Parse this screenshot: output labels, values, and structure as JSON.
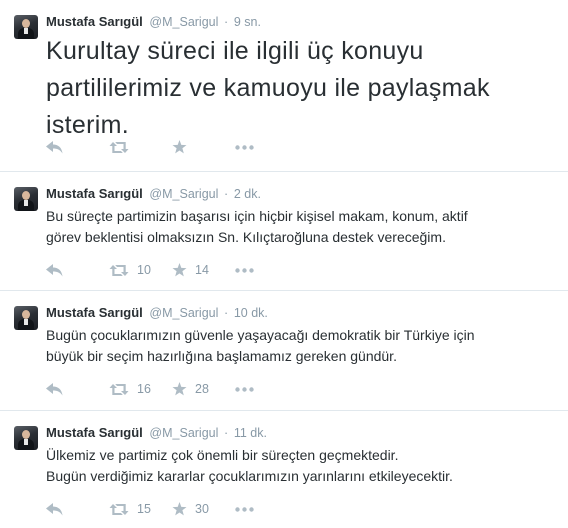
{
  "tweets": [
    {
      "name": "Mustafa Sarıgül",
      "handle": "@M_Sarigul",
      "separator": "·",
      "time": "9 sn.",
      "lines": [
        "Kurultay süreci ile ilgili üç konuyu",
        "partililerimiz ve kamuoyu ile paylaşmak",
        "isterim."
      ],
      "retweets": "",
      "favorites": ""
    },
    {
      "name": "Mustafa Sarıgül",
      "handle": "@M_Sarigul",
      "separator": "·",
      "time": "2 dk.",
      "lines": [
        "Bu süreçte partimizin başarısı için hiçbir kişisel makam, konum, aktif",
        "görev beklentisi olmaksızın Sn. Kılıçtaroğluna destek vereceğim."
      ],
      "retweets": "10",
      "favorites": "14"
    },
    {
      "name": "Mustafa Sarıgül",
      "handle": "@M_Sarigul",
      "separator": "·",
      "time": "10 dk.",
      "lines": [
        "Bugün çocuklarımızın güvenle yaşayacağı demokratik bir Türkiye için",
        "büyük bir seçim hazırlığına başlamamız gereken gündür."
      ],
      "retweets": "16",
      "favorites": "28"
    },
    {
      "name": "Mustafa Sarıgül",
      "handle": "@M_Sarigul",
      "separator": "·",
      "time": "11 dk.",
      "lines": [
        "Ülkemiz ve partimiz çok önemli bir süreçten geçmektedir.",
        "Bugün verdiğimiz kararlar çocuklarımızın yarınlarını etkileyecektir."
      ],
      "retweets": "15",
      "favorites": "30"
    }
  ],
  "icons": {
    "reply": "reply-icon",
    "retweet": "retweet-icon",
    "favorite": "star-icon",
    "more": "more-icon"
  },
  "colors": {
    "text": "#292f33",
    "meta": "#8899a6",
    "icon": "#afbcc5",
    "divider": "#e1e8ed"
  }
}
